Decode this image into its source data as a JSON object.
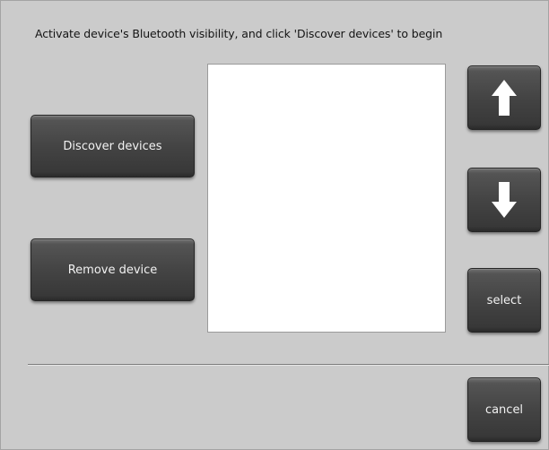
{
  "instruction": "Activate device's Bluetooth visibility, and click 'Discover devices' to begin",
  "buttons": {
    "discover": "Discover devices",
    "remove": "Remove device",
    "select": "select",
    "cancel": "cancel"
  },
  "icons": {
    "up": "arrow-up-icon",
    "down": "arrow-down-icon"
  },
  "device_list": []
}
